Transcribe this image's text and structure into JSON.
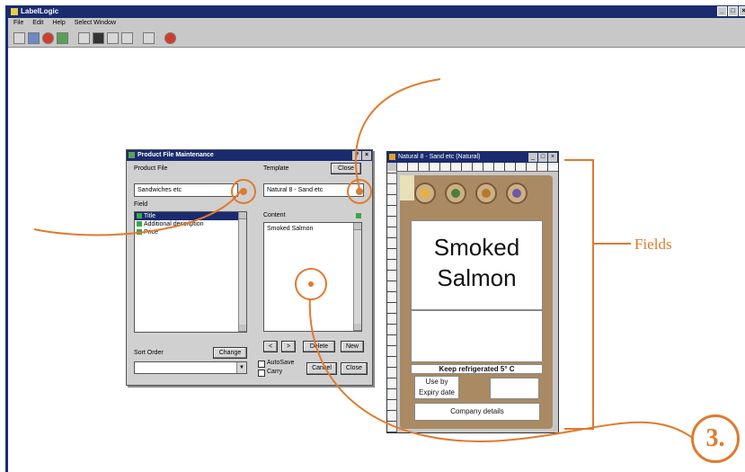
{
  "app": {
    "title": "LabelLogic",
    "menu": [
      "File",
      "Edit",
      "Help",
      "Select Window"
    ],
    "toolbar_icons": [
      "new-icon",
      "open-icon",
      "record-icon",
      "image-icon",
      "grid-icon",
      "binoculars-icon",
      "copy-icon",
      "chart-icon",
      "zoom-icon",
      "print-icon"
    ]
  },
  "dialog": {
    "title": "Product File Maintenance",
    "product_file_label": "Product File",
    "product_file_value": "Sandwiches etc",
    "template_label": "Template",
    "template_close": "Close",
    "template_value": "Natural 8 - Sand etc",
    "field_label": "Field",
    "field_items": [
      "Title",
      "Additional description",
      "Price"
    ],
    "content_label": "Content",
    "content_value": "Smoked Salmon",
    "sort_order_label": "Sort Order",
    "change_button": "Change",
    "nav_prev": "<",
    "nav_next": ">",
    "delete_button": "Delete",
    "new_button": "New",
    "autosave_label": "AutoSave",
    "carry_label": "Carry",
    "cancel_button": "Cancel",
    "close_button": "Close"
  },
  "label_window": {
    "title": "Natural 8 - Sand etc (Natural)",
    "main_text_line1": "Smoked",
    "main_text_line2": "Salmon",
    "storage_text": "Keep refrigerated 5° C",
    "use_by_line1": "Use by",
    "use_by_line2": "Expiry date",
    "company_text": "Company details",
    "icon_colors": [
      "#e6b23a",
      "#4f7d3a",
      "#b7782e",
      "#6a5aa5"
    ]
  },
  "annotations": {
    "fields_label": "Fields",
    "step_number": "3.",
    "accent_color": "#e07a2e"
  }
}
